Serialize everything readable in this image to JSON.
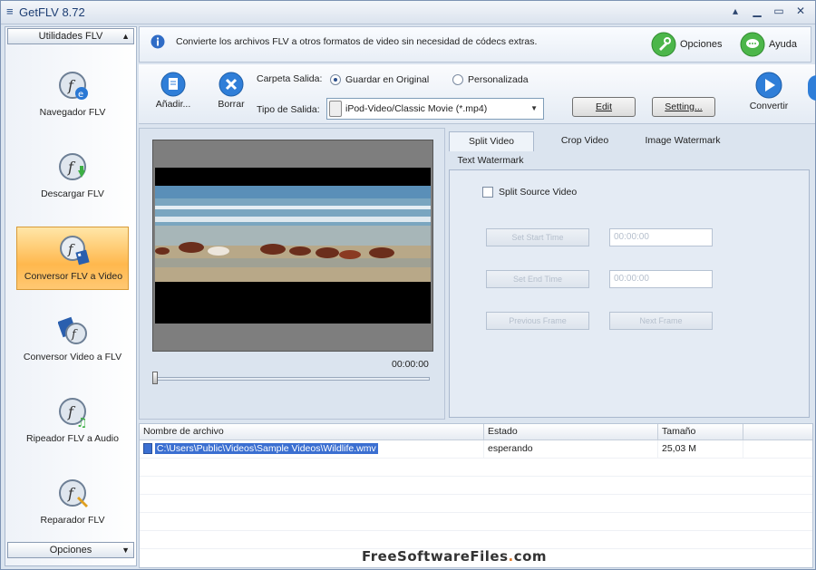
{
  "app": {
    "title": "GetFLV 8.72"
  },
  "sidebar": {
    "top_dropdown": "Utilidades FLV",
    "bottom_dropdown": "Opciones",
    "items": [
      {
        "label": "Navegador FLV",
        "icon": "flash-ie-icon"
      },
      {
        "label": "Descargar FLV",
        "icon": "flash-download-icon"
      },
      {
        "label": "Conversor FLV a Video",
        "icon": "flash-film-icon",
        "active": true
      },
      {
        "label": "Conversor Video a FLV",
        "icon": "film-flash-icon"
      },
      {
        "label": "Ripeador FLV a Audio",
        "icon": "flash-music-icon"
      },
      {
        "label": "Reparador FLV",
        "icon": "flash-repair-icon"
      }
    ]
  },
  "infobar": {
    "message": "Convierte los archivos FLV a otros formatos de video sin necesidad de códecs extras.",
    "options_label": "Opciones",
    "help_label": "Ayuda"
  },
  "toolbar": {
    "add_label": "Añadir...",
    "delete_label": "Borrar",
    "output_folder_label": "Carpeta Salida:",
    "radio_original": "Guardar en Original",
    "radio_custom": "Personalizada",
    "output_type_label": "Tipo de Salida:",
    "output_type_value": "iPod-Video/Classic Movie (*.mp4)",
    "edit_label": "Edit",
    "setting_label": "Setting...",
    "convert_label": "Convertir"
  },
  "preview": {
    "time": "00:00:00"
  },
  "tabs": {
    "items": [
      "Split Video",
      "Crop Video",
      "Image Watermark",
      "Text Watermark"
    ],
    "split_source_label": "Split Source Video",
    "start_time_btn": "Set Start Time",
    "end_time_btn": "Set End Time",
    "start_value": "00:00:00",
    "end_value": "00:00:00",
    "prev_frame_btn": "Previous Frame",
    "next_frame_btn": "Next Frame"
  },
  "filelist": {
    "columns": [
      "Nombre de archivo",
      "Estado",
      "Tamaño"
    ],
    "rows": [
      {
        "name": "C:\\Users\\Public\\Videos\\Sample Videos\\Wildlife.wmv",
        "status": "esperando",
        "size": "25,03 M"
      }
    ]
  },
  "watermark": {
    "brand": "FreeSoftwareFiles",
    "dot": ".",
    "tld": "com"
  },
  "colors": {
    "accent": "#3b6fd1",
    "active_item": "#ffb84d",
    "title": "#1d3e73"
  }
}
